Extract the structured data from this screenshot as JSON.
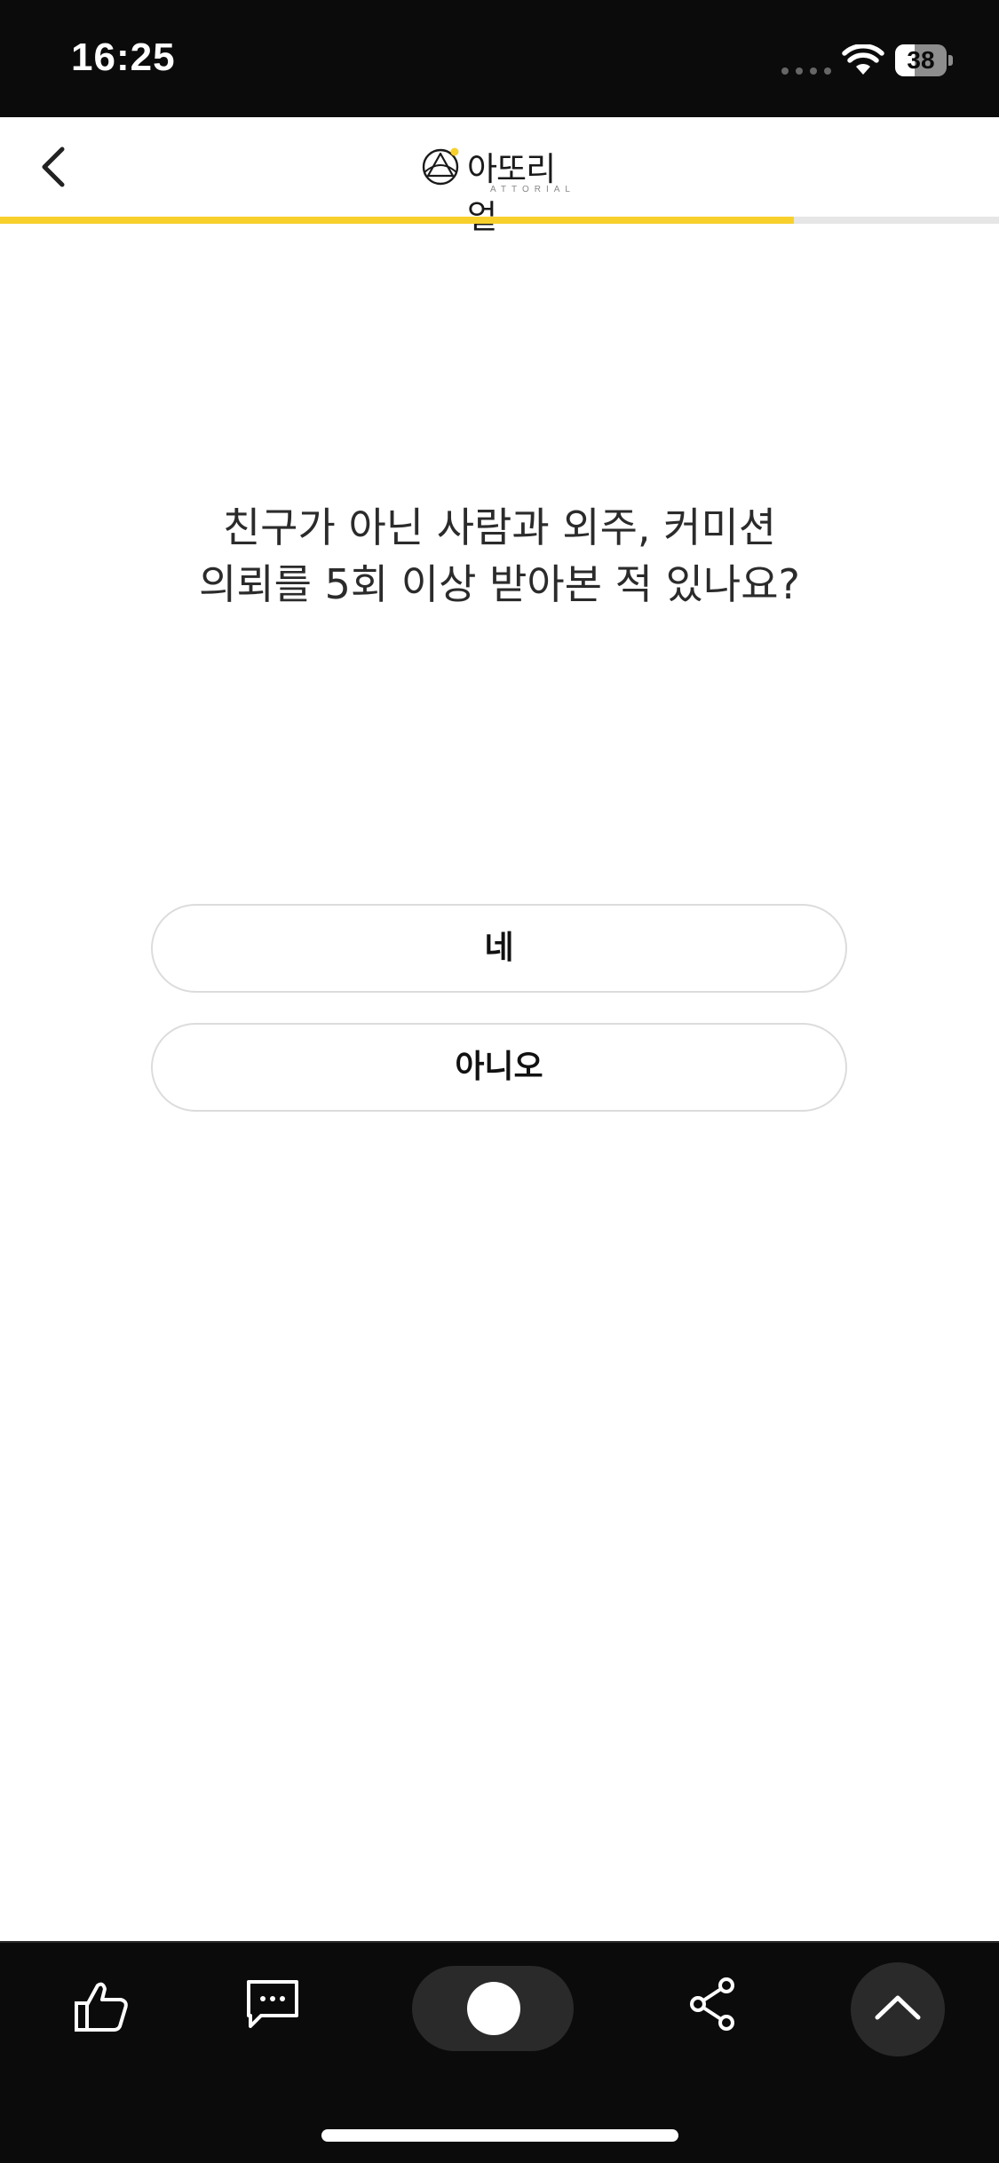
{
  "status_bar": {
    "time": "16:25",
    "battery_level": "38",
    "battery_fraction": 0.38,
    "icons": [
      "signal-dots-icon",
      "wifi-icon",
      "battery-icon"
    ]
  },
  "header": {
    "back_icon": "chevron-left-icon",
    "logo_text": "아또리얼",
    "logo_subtext": "ATTORIAL"
  },
  "progress": {
    "fraction": 0.795,
    "fill_color": "#f8d02c",
    "track_color": "#e6e6e6"
  },
  "question": {
    "line1": "친구가 아닌 사람과 외주, 커미션",
    "line2": "의뢰를 5회 이상 받아본 적 있나요?"
  },
  "answers": {
    "yes_label": "네",
    "no_label": "아니오"
  },
  "bottom_bar": {
    "icons": [
      "thumbs-up-icon",
      "comment-icon",
      "toggle-icon",
      "share-icon",
      "chevron-up-icon"
    ]
  },
  "colors": {
    "accent": "#f8d02c",
    "dark_bar": "#0b0b0b",
    "text": "#2b2b2b"
  }
}
